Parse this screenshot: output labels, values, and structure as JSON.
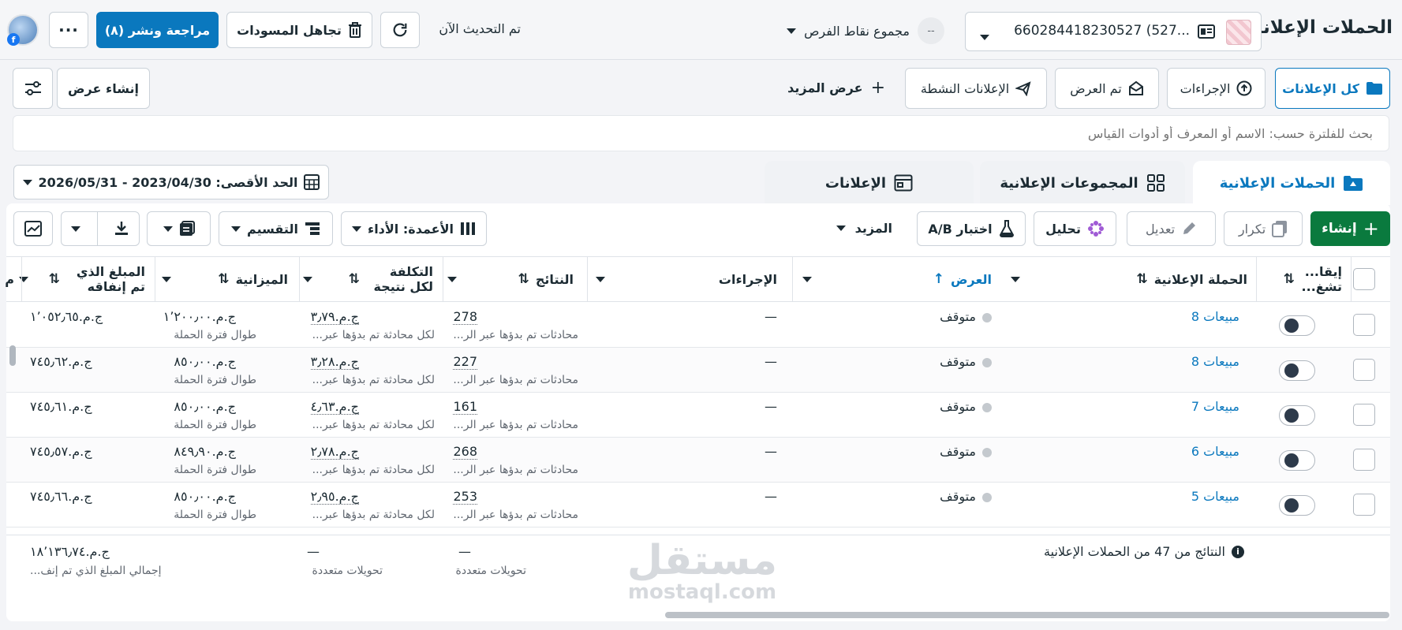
{
  "header": {
    "title": "الحملات الإعلانية",
    "account_label": "660284418230527 (527...",
    "opportunity_label": "مجموع نقاط الفرص",
    "opportunity_value": "--",
    "updated_text": "تم التحديث الآن",
    "discard_label": "تجاهل المسودات",
    "review_label": "مراجعة ونشر (٨)",
    "more_icon": "more-icon"
  },
  "filters": {
    "all_ads": "كل الإعلانات",
    "actions": "الإجراءات",
    "shown": "تم العرض",
    "active_ads": "الإعلانات النشطة",
    "show_more": "عرض المزيد",
    "create_view": "إنشاء عرض"
  },
  "search": {
    "placeholder": "بحث للفلترة حسب: الاسم أو المعرف أو أدوات القياس"
  },
  "tabs": {
    "campaigns": "الحملات الإعلانية",
    "adsets": "المجموعات الإعلانية",
    "ads": "الإعلانات"
  },
  "date_range": "الحد الأقصى: 2023/04/30 - 2026/05/31",
  "toolbar": {
    "create": "إنشاء",
    "duplicate": "تكرار",
    "edit": "تعديل",
    "analyze": "تحليل",
    "ab_test": "اختبار A/B",
    "more": "المزيد",
    "columns": "الأعمدة: الأداء",
    "breakdown": "التقسيم"
  },
  "columns": {
    "toggle": "إيقا... تشغ...",
    "campaign": "الحملة الإعلانية",
    "delivery": "العرض",
    "actions": "الإجراءات",
    "results": "النتائج",
    "cost": "التكلفة لكل نتيجة",
    "budget": "الميزانية",
    "spent": "المبلغ الذي تم إنفاقه",
    "extra": "م"
  },
  "rows": [
    {
      "name": "مبيعات 8",
      "status": "متوقف",
      "actions": "—",
      "results": "278",
      "results_sub": "محادثات تم بدؤها عبر الر...",
      "cost": "ج.م.٣٫٧٩",
      "cost_sub": "لكل محادثة تم بدؤها عبر...",
      "budget": "ج.م.١٬٢٠٠٫٠٠",
      "budget_sub": "طوال فترة الحملة",
      "spent": "ج.م.١٬٠٥٢٫٦٥"
    },
    {
      "name": "مبيعات 8",
      "status": "متوقف",
      "actions": "—",
      "results": "227",
      "results_sub": "محادثات تم بدؤها عبر الر...",
      "cost": "ج.م.٣٫٢٨",
      "cost_sub": "لكل محادثة تم بدؤها عبر...",
      "budget": "ج.م.٨٥٠٫٠٠",
      "budget_sub": "طوال فترة الحملة",
      "spent": "ج.م.٧٤٥٫٦٢"
    },
    {
      "name": "مبيعات 7",
      "status": "متوقف",
      "actions": "—",
      "results": "161",
      "results_sub": "محادثات تم بدؤها عبر الر...",
      "cost": "ج.م.٤٫٦٣",
      "cost_sub": "لكل محادثة تم بدؤها عبر...",
      "budget": "ج.م.٨٥٠٫٠٠",
      "budget_sub": "طوال فترة الحملة",
      "spent": "ج.م.٧٤٥٫٦١"
    },
    {
      "name": "مبيعات 6",
      "status": "متوقف",
      "actions": "—",
      "results": "268",
      "results_sub": "محادثات تم بدؤها عبر الر...",
      "cost": "ج.م.٢٫٧٨",
      "cost_sub": "لكل محادثة تم بدؤها عبر...",
      "budget": "ج.م.٨٤٩٫٩٠",
      "budget_sub": "طوال فترة الحملة",
      "spent": "ج.م.٧٤٥٫٥٧"
    },
    {
      "name": "مبيعات 5",
      "status": "متوقف",
      "actions": "—",
      "results": "253",
      "results_sub": "محادثات تم بدؤها عبر الر...",
      "cost": "ج.م.٢٫٩٥",
      "cost_sub": "لكل محادثة تم بدؤها عبر...",
      "budget": "ج.م.٨٥٠٫٠٠",
      "budget_sub": "طوال فترة الحملة",
      "spent": "ج.م.٧٤٥٫٦٦"
    }
  ],
  "footer": {
    "summary": "النتائج من 47 من الحملات الإعلانية",
    "results_dash": "—",
    "results_sub": "تحويلات متعددة",
    "cost_dash": "—",
    "cost_sub": "تحويلات متعددة",
    "spent_total": "ج.م.١٨٬١٣٦٫٧٤",
    "spent_sub": "إجمالي المبلغ الذي تم إنف..."
  },
  "watermark": {
    "arabic": "مستقل",
    "latin": "mostaql.com"
  }
}
